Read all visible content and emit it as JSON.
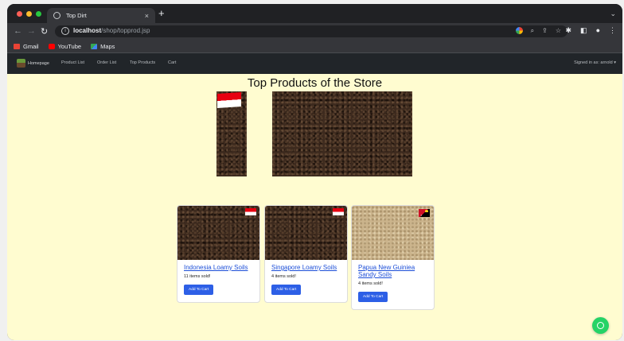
{
  "browser": {
    "tab_title": "Top Dirt",
    "tab_close": "×",
    "new_tab": "+",
    "tab_menu": "⌄",
    "url_host": "localhost",
    "url_path": "/shop/topprod.jsp",
    "bookmarks": [
      {
        "label": "Gmail",
        "color": "#ea4335"
      },
      {
        "label": "YouTube",
        "color": "#ff0000"
      },
      {
        "label": "Maps",
        "color": "#34a853"
      }
    ]
  },
  "navbar": {
    "brand": "Homepage",
    "links": [
      "Product List",
      "Order List",
      "Top Products",
      "Cart"
    ],
    "signed_in": "Signed in as: arnold ▾"
  },
  "page": {
    "title": "Top Products of the Store"
  },
  "products": [
    {
      "name": "Indonesia Loamy Soils",
      "sold": "11  items sold!",
      "button": "Add To Cart",
      "flag": "indonesia",
      "soil": "loamy"
    },
    {
      "name": "Singapore Loamy Soils",
      "sold": "4  items sold!",
      "button": "Add To Cart",
      "flag": "indonesia",
      "soil": "loamy"
    },
    {
      "name": "Papua New Guiniea Sandy Soils",
      "sold": "4  items sold!",
      "button": "Add To Cart",
      "flag": "papua-new-guinea",
      "soil": "sandy"
    }
  ],
  "colors": {
    "page_bg": "#fffcd0",
    "navbar_bg": "#212529",
    "button": "#2d5fe6",
    "link": "#1d4fd8",
    "whatsapp": "#25d366"
  }
}
